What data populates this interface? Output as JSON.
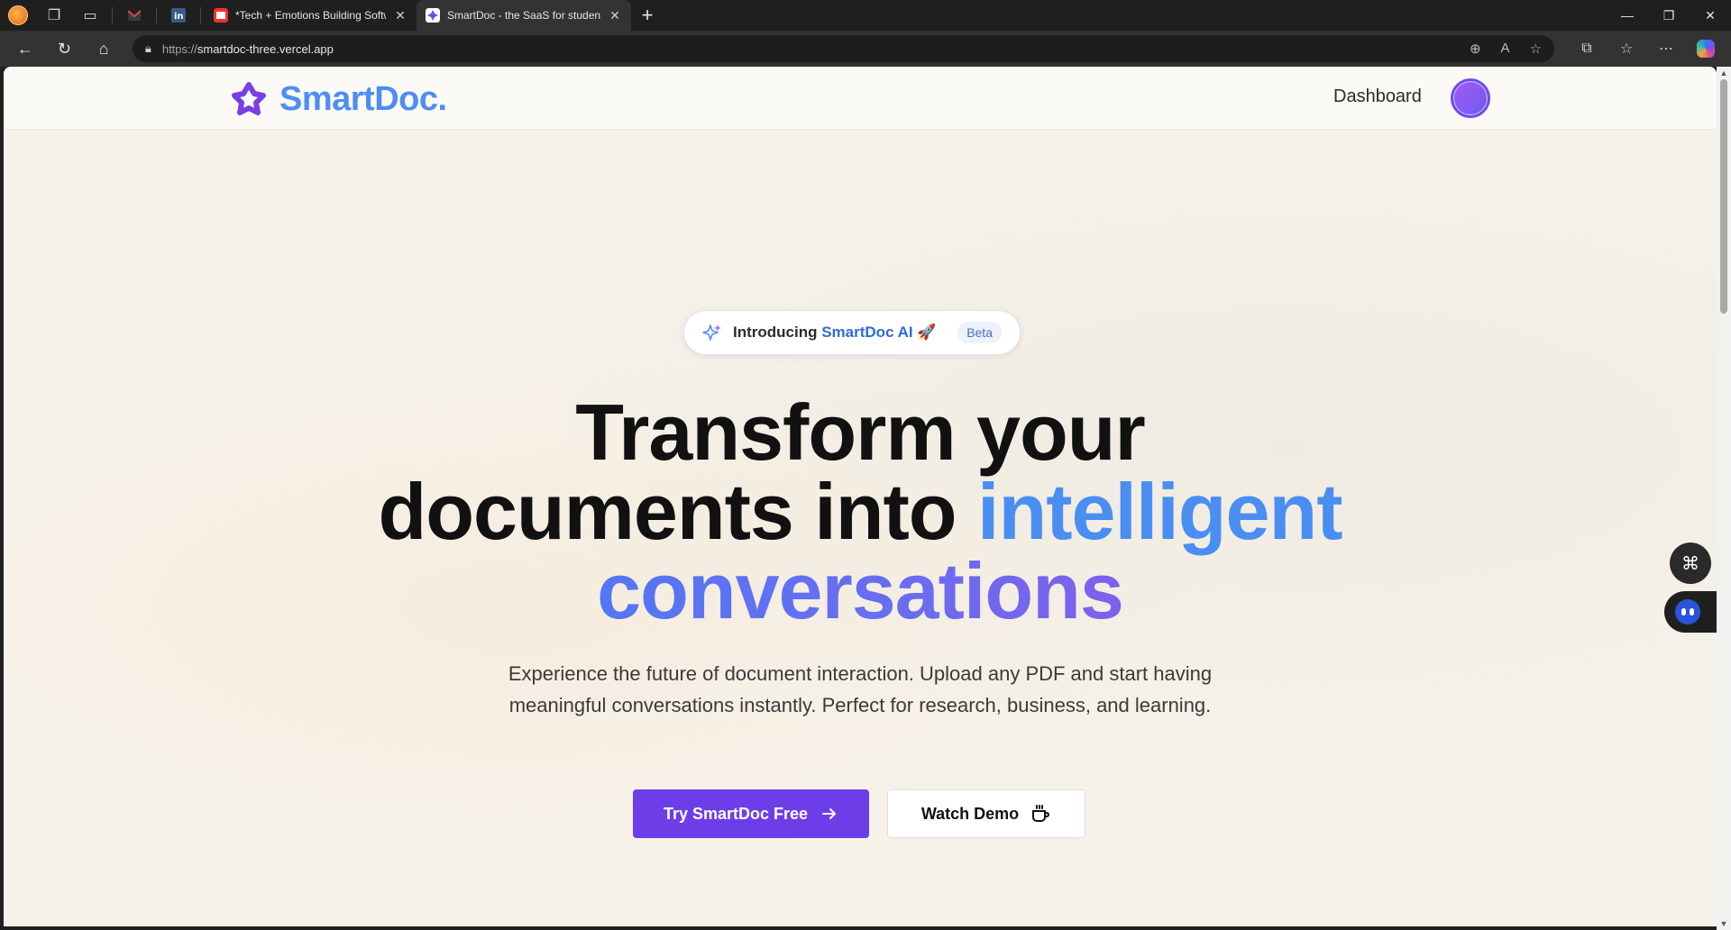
{
  "browser": {
    "tabs": [
      {
        "title": "*Tech + Emotions Building Softwa",
        "favicon": "youtube-icon",
        "active": false
      },
      {
        "title": "SmartDoc - the SaaS for students",
        "favicon": "smartdoc-icon",
        "active": true
      }
    ],
    "pinned": [
      "gmail-icon",
      "linkedin-icon"
    ],
    "url_scheme": "https://",
    "url_host": "smartdoc-three.vercel.app"
  },
  "header": {
    "logo_text": "SmartDoc.",
    "nav_dashboard": "Dashboard"
  },
  "hero": {
    "badge_prefix": "Introducing",
    "badge_brand": "SmartDoc AI",
    "badge_emoji": "🚀",
    "badge_pill": "Beta",
    "headline_line1": "Transform your",
    "headline_line2_dark": "documents into",
    "headline_line2_accent": "intelligent",
    "headline_line3": "conversations",
    "subtext": "Experience the future of document interaction. Upload any PDF and start having meaningful conversations instantly. Perfect for research, business, and learning.",
    "cta_primary": "Try SmartDoc Free",
    "cta_secondary": "Watch Demo"
  },
  "colors": {
    "brand_purple": "#6d3ee8",
    "brand_blue": "#4a8ef2",
    "background": "#f6f2ea"
  }
}
